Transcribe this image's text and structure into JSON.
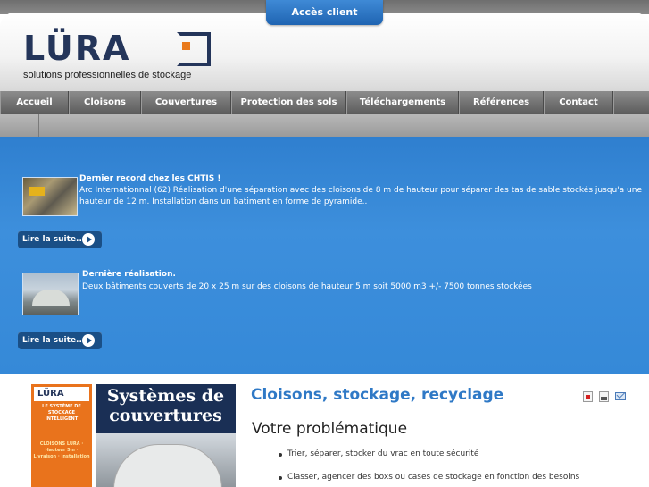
{
  "header": {
    "access_label": "Accès client",
    "logo_text": "LÜRA",
    "logo_tagline": "solutions professionnelles de stockage"
  },
  "nav": {
    "items": [
      {
        "label": "Accueil"
      },
      {
        "label": "Cloisons"
      },
      {
        "label": "Couvertures"
      },
      {
        "label": "Protection des sols"
      },
      {
        "label": "Téléchargements"
      },
      {
        "label": "Références"
      },
      {
        "label": "Contact"
      }
    ]
  },
  "news": [
    {
      "title": "Dernier record chez les CHTIS !",
      "body": "Arc Internationnal (62) Réalisation d'une séparation avec des cloisons de 8 m de hauteur  pour séparer des tas de sable stockés jusqu'a une hauteur de 12 m. Installation dans un batiment en forme de pyramide..",
      "read_more": "Lire la suite..."
    },
    {
      "title": "Dernière réalisation.",
      "body": "Deux bâtiments couverts de 20 x 25 m sur des cloisons de hauteur 5 m soit 5000 m3   +/-  7500 tonnes stockées",
      "read_more": "Lire la suite..."
    }
  ],
  "promo": {
    "logo": "LÜRA",
    "small_text_1": "LE SYSTÈME DE STOCKAGE INTELLIGENT",
    "small_text_2": "CLOISONS LÜRA · Hauteur 5m · Livraison · Installation",
    "heading": "Systèmes de couvertures"
  },
  "main": {
    "page_title": "Cloisons, stockage, recyclage",
    "section_title": "Votre problématique",
    "bullets": [
      "Trier, séparer, stocker du vrac en toute sécurité",
      "Classer, agencer des boxs ou cases de stockage en fonction des besoins"
    ]
  },
  "icons": [
    "pdf-icon",
    "print-icon",
    "mail-icon"
  ],
  "colors": {
    "banner_blue": "#3589d8",
    "nav_gray": "#6e6e6e",
    "title_blue": "#2f79c6",
    "logo_navy": "#24355a",
    "accent_orange": "#e97a1c"
  }
}
